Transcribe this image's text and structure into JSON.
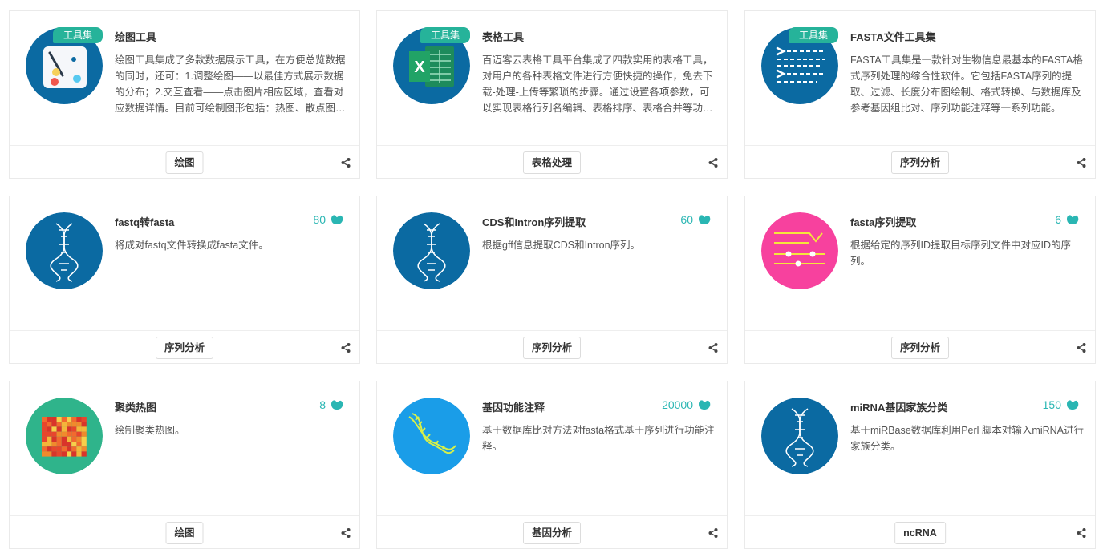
{
  "colors": {
    "badge": "#26b39a",
    "count": "#2ab6b3",
    "circle_blue": "#0b6aa2",
    "circle_pink": "#f7419e",
    "circle_green": "#2fb48b",
    "circle_lightblue": "#1a9de8"
  },
  "cards": [
    {
      "badge": "工具集",
      "title": "绘图工具",
      "desc": "绘图工具集成了多款数据展示工具，在方便总览数据的同时，还可：1.调整绘图——以最佳方式展示数据的分布；2.交互查看——点击图片相应区域，查看对应数据详情。目前可绘制图形包括：热图、散点图、柱状图、饼图等。",
      "count": "",
      "tag": "绘图",
      "icon": "palette-icon"
    },
    {
      "badge": "工具集",
      "title": "表格工具",
      "desc": "百迈客云表格工具平台集成了四款实用的表格工具，对用户的各种表格文件进行方便快捷的操作，免去下载-处理-上传等繁琐的步骤。通过设置各项参数，可以实现表格行列名编辑、表格排序、表格合并等功能。",
      "count": "",
      "tag": "表格处理",
      "icon": "excel-icon"
    },
    {
      "badge": "工具集",
      "title": "FASTA文件工具集",
      "desc": "FASTA工具集是一款针对生物信息最基本的FASTA格式序列处理的综合性软件。它包括FASTA序列的提取、过滤、长度分布图绘制、格式转换、与数据库及参考基因组比对、序列功能注释等一系列功能。",
      "count": "",
      "tag": "序列分析",
      "icon": "fasta-icon"
    },
    {
      "badge": "",
      "title": "fastq转fasta",
      "desc": "将成对fastq文件转换成fasta文件。",
      "count": "80",
      "tag": "序列分析",
      "icon": "dna-icon"
    },
    {
      "badge": "",
      "title": "CDS和Intron序列提取",
      "desc": "根据gff信息提取CDS和Intron序列。",
      "count": "60",
      "tag": "序列分析",
      "icon": "dna-icon"
    },
    {
      "badge": "",
      "title": "fasta序列提取",
      "desc": "根据给定的序列ID提取目标序列文件中对应ID的序列。",
      "count": "6",
      "tag": "序列分析",
      "icon": "filter-sliders-icon"
    },
    {
      "badge": "",
      "title": "聚类热图",
      "desc": "绘制聚类热图。",
      "count": "8",
      "tag": "绘图",
      "icon": "heatmap-icon"
    },
    {
      "badge": "",
      "title": "基因功能注释",
      "desc": "基于数据库比对方法对fasta格式基于序列进行功能注释。",
      "count": "20000",
      "tag": "基因分析",
      "icon": "dna-yellow-icon"
    },
    {
      "badge": "",
      "title": "miRNA基因家族分类",
      "desc": "基于miRBase数据库利用Perl 脚本对输入miRNA进行家族分类。",
      "count": "150",
      "tag": "ncRNA",
      "icon": "dna-icon"
    }
  ]
}
